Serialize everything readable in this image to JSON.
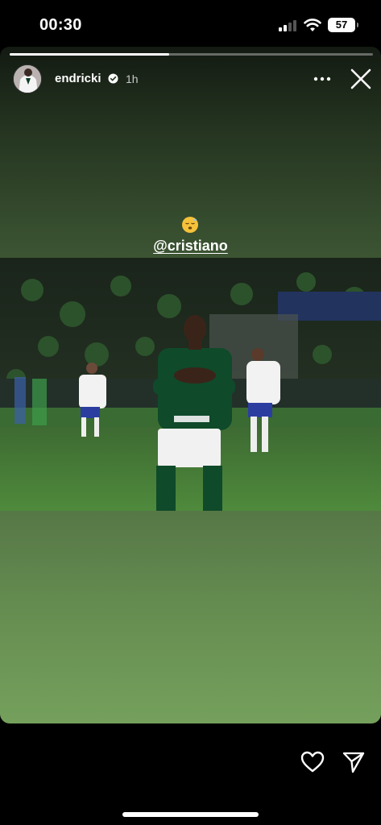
{
  "status_bar": {
    "time": "00:30",
    "battery": "57"
  },
  "story": {
    "progress": 0.44,
    "username": "endricki",
    "verified": true,
    "time_ago": "1h",
    "mention": "@cristiano",
    "sticker_icon": "sleepy-emoji-icon",
    "photo_subject": "player-in-green-kit-hands-on-chest-icon"
  },
  "actions": {
    "like_icon": "heart-icon",
    "share_icon": "send-icon",
    "more_icon": "more-dots-icon",
    "close_icon": "close-icon"
  },
  "colors": {
    "background": "#000000",
    "accent": "#ffffff",
    "verified": "#ffffff"
  }
}
